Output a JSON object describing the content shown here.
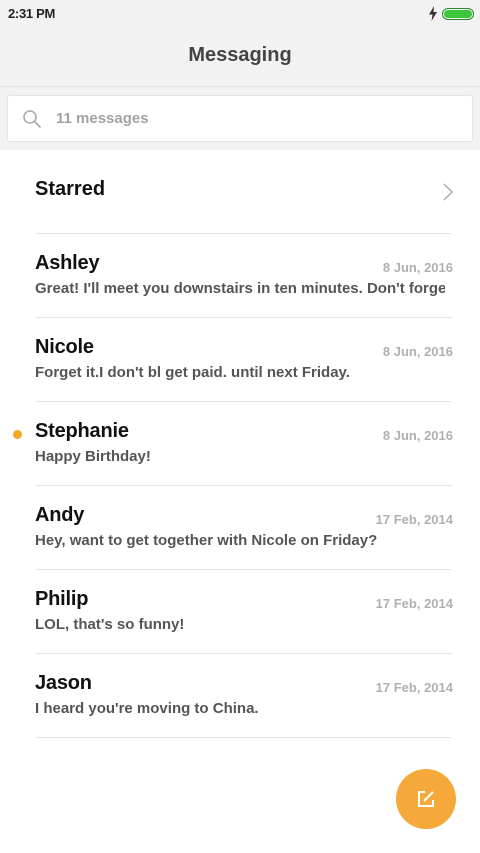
{
  "status_bar": {
    "time": "2:31 PM",
    "battery_level": 1.0,
    "battery_color": "#3cc63c",
    "icons": [
      "charging-bolt-icon",
      "battery-icon"
    ]
  },
  "header": {
    "title": "Messaging"
  },
  "search": {
    "placeholder": "11 messages",
    "icon": "search-icon"
  },
  "starred": {
    "label": "Starred",
    "icon": "chevron-right-icon"
  },
  "conversations": [
    {
      "name": "Ashley",
      "date": "8 Jun, 2016",
      "preview": "Great! I'll meet you downstairs in ten minutes. Don't forge",
      "unread": false
    },
    {
      "name": "Nicole",
      "date": "8 Jun, 2016",
      "preview": "Forget it.I don't bl get paid. until next Friday.",
      "unread": false
    },
    {
      "name": "Stephanie",
      "date": "8 Jun, 2016",
      "preview": "Happy Birthday!",
      "unread": true
    },
    {
      "name": "Andy",
      "date": "17 Feb, 2014",
      "preview": "Hey, want to get together with Nicole on Friday?",
      "unread": false
    },
    {
      "name": "Philip",
      "date": "17 Feb, 2014",
      "preview": "LOL, that's so funny!",
      "unread": false
    },
    {
      "name": "Jason",
      "date": "17 Feb, 2014",
      "preview": "I heard you're moving to China.",
      "unread": false
    }
  ],
  "fab": {
    "icon": "compose-icon",
    "color": "#f6a93b"
  },
  "colors": {
    "accent": "#f5a623",
    "header_bg": "#f2f2f2"
  }
}
